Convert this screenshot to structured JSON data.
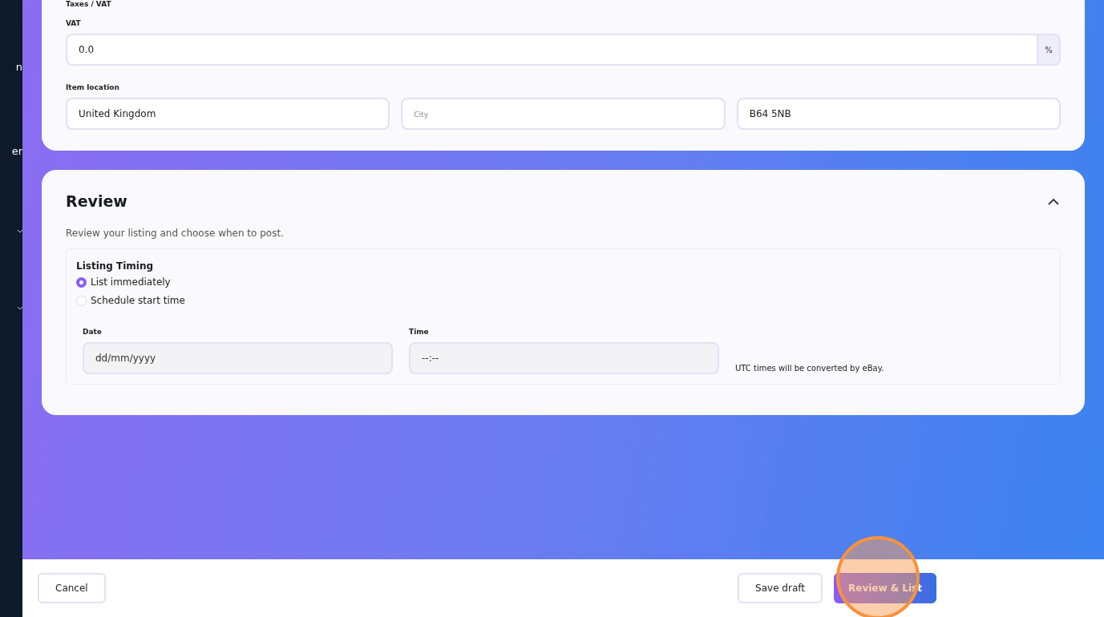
{
  "sidebar": {
    "items": [
      {
        "kind": "text",
        "label": "n"
      },
      {
        "kind": "text",
        "label": "er"
      },
      {
        "kind": "chevron"
      },
      {
        "kind": "chevron"
      }
    ]
  },
  "location_card": {
    "section_label": "Taxes / VAT",
    "vat": {
      "label": "VAT",
      "value": "0.0",
      "suffix": "%"
    },
    "item_location": {
      "label": "Item location",
      "fields": [
        {
          "value": "United Kingdom"
        },
        {
          "placeholder": "City"
        },
        {
          "value": "B64 5NB"
        }
      ]
    }
  },
  "review": {
    "title": "Review",
    "expanded": true,
    "description": "Review your listing and choose when to post.",
    "timing": {
      "title": "Listing Timing",
      "options": [
        {
          "label": "List immediately",
          "selected": true
        },
        {
          "label": "Schedule start time",
          "selected": false
        }
      ],
      "date": {
        "label": "Date",
        "placeholder": "dd/mm/yyyy"
      },
      "time": {
        "label": "Time",
        "placeholder": "--:--"
      },
      "note": "UTC times will be converted by eBay."
    }
  },
  "footer": {
    "cancel": "Cancel",
    "save": "Save draft",
    "submit": "Review & List",
    "highlighted": true
  }
}
